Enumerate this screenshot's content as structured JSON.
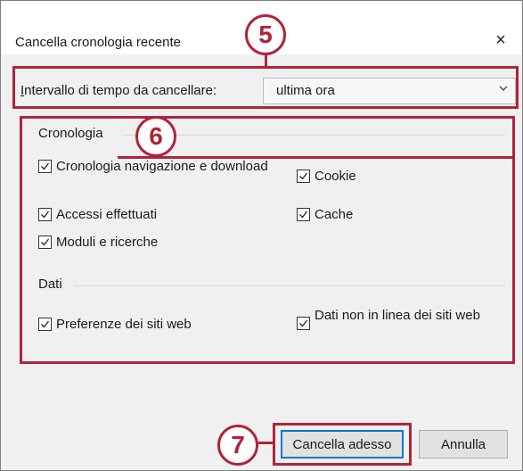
{
  "window": {
    "title": "Cancella cronologia recente",
    "close_glyph": "×"
  },
  "interval": {
    "label_first": "I",
    "label_rest": "ntervallo di tempo da cancellare:",
    "value": "ultima ora"
  },
  "history": {
    "title": "Cronologia",
    "items": [
      {
        "label": "Cronologia navigazione e download",
        "checked": true
      },
      {
        "label": "Cookie",
        "checked": true
      },
      {
        "label": "Accessi effettuati",
        "checked": true
      },
      {
        "label": "Cache",
        "checked": true
      },
      {
        "label": "Moduli e ricerche",
        "checked": true
      }
    ]
  },
  "data_section": {
    "title": "Dati",
    "items": [
      {
        "label": "Preferenze dei siti web",
        "checked": true
      },
      {
        "label": "Dati non in linea dei siti web",
        "checked": true
      }
    ]
  },
  "buttons": {
    "clear": "Cancella adesso",
    "cancel": "Annulla"
  },
  "annotations": {
    "badge5": "5",
    "badge6": "6",
    "badge7": "7",
    "color": "#b0233b"
  }
}
